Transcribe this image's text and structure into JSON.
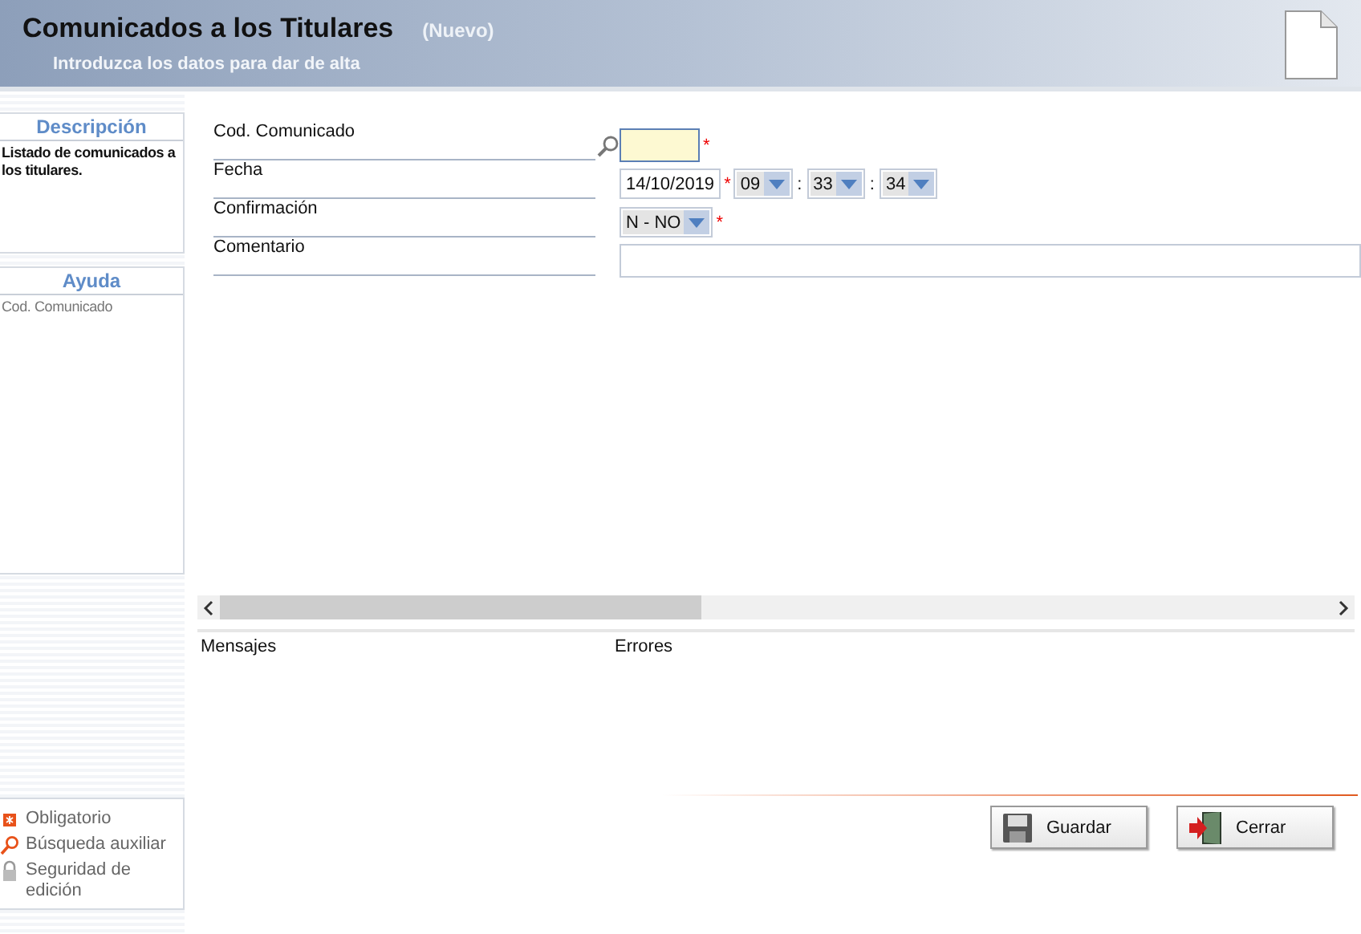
{
  "header": {
    "title": "Comunicados a los Titulares",
    "status": "(Nuevo)",
    "subtitle": "Introduzca los datos para dar de alta"
  },
  "description": {
    "title": "Descripción",
    "text": "Listado de comunicados a los titulares."
  },
  "help": {
    "title": "Ayuda",
    "text": "Cod. Comunicado"
  },
  "fields": [
    {
      "label": "Cod. Comunicado",
      "kind": "lookup",
      "required_mark": "*"
    },
    {
      "label": "Fecha",
      "kind": "datetime",
      "date": "14/10/2019",
      "required_mark": "*",
      "time": [
        {
          "value": "09"
        },
        {
          "separator": ":",
          "value": "33"
        },
        {
          "separator": ":",
          "value": "34"
        }
      ]
    },
    {
      "label": "Confirmación",
      "kind": "select",
      "value": "N - NO",
      "required_mark": "*"
    },
    {
      "label": "Comentario",
      "kind": "text"
    }
  ],
  "messages": {
    "messages_label": "Mensajes",
    "errors_label": "Errores"
  },
  "legend": [
    {
      "kind": "required",
      "label": "Obligatorio"
    },
    {
      "kind": "search",
      "label": "Búsqueda auxiliar"
    },
    {
      "kind": "lock",
      "label": "Seguridad de edición"
    }
  ],
  "buttons": [
    {
      "kind": "save",
      "label": "Guardar"
    },
    {
      "kind": "close",
      "label": "Cerrar"
    }
  ]
}
